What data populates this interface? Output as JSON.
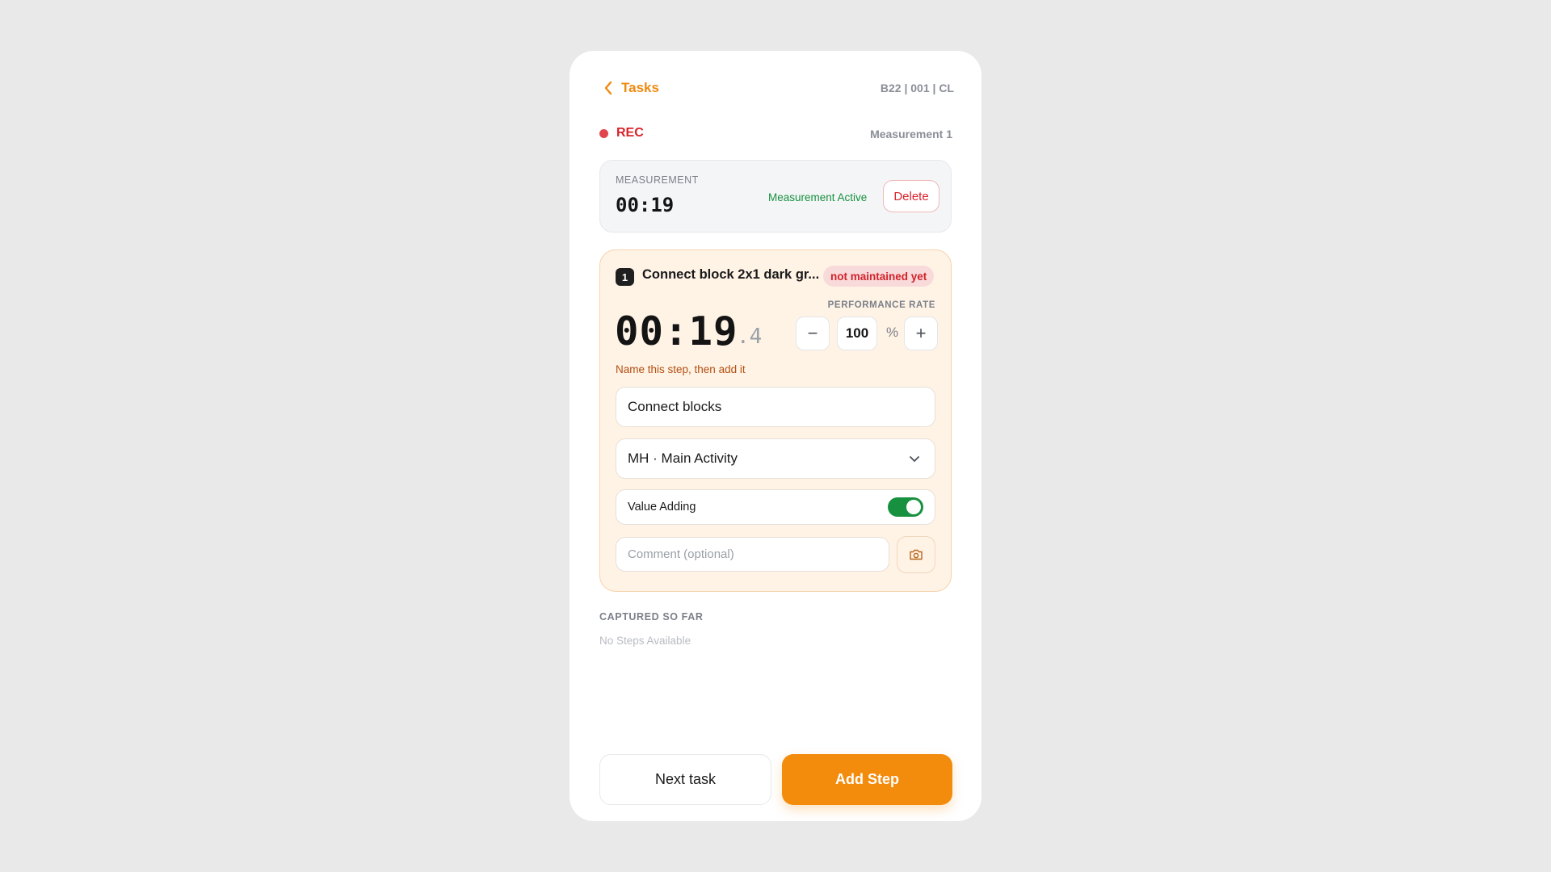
{
  "header": {
    "back_label": "Tasks",
    "code": "B22 | 001 | CL"
  },
  "recording": {
    "label": "REC",
    "measurement_name": "Measurement 1"
  },
  "measurement": {
    "label": "MEASUREMENT",
    "time": "00:19",
    "status": "Measurement Active",
    "delete_label": "Delete"
  },
  "step": {
    "number": "1",
    "title": "Connect block 2x1 dark gr...",
    "badge": "not maintained yet",
    "performance_label": "PERFORMANCE RATE",
    "time_main": "00:19",
    "time_fraction": ".4",
    "minus_label": "−",
    "plus_label": "+",
    "rate_value": "100",
    "rate_unit": "%",
    "hint": "Name this step, then add it",
    "name_value": "Connect blocks",
    "activity_selected": "MH · Main Activity",
    "value_adding_label": "Value Adding",
    "value_adding_on": true,
    "comment_placeholder": "Comment (optional)"
  },
  "captured": {
    "label": "CAPTURED SO FAR",
    "empty_text": "No Steps Available"
  },
  "footer": {
    "next_label": "Next task",
    "add_label": "Add Step"
  },
  "colors": {
    "accent": "#f38b0c",
    "rec": "#d8242c",
    "active": "#17913f",
    "step_bg": "#fff3e6"
  }
}
